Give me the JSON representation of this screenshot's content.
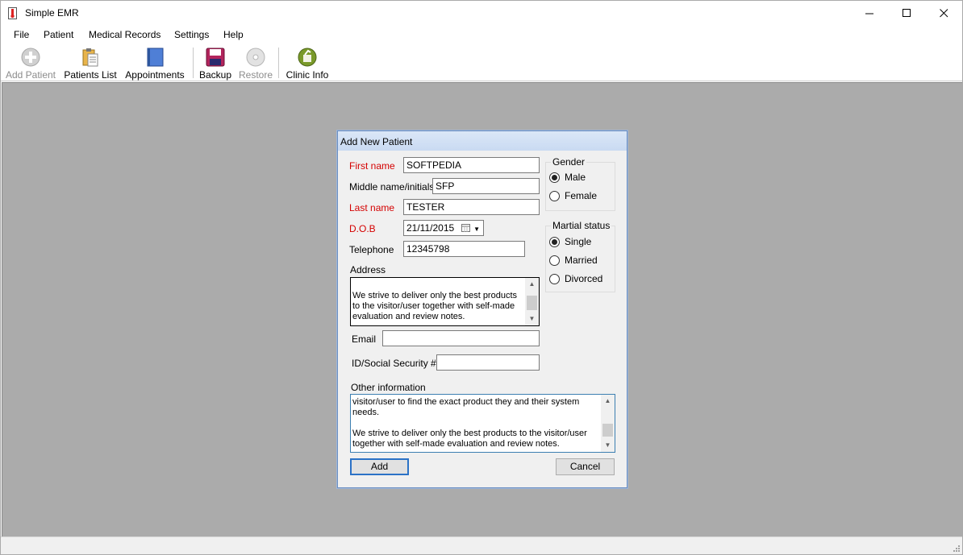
{
  "window": {
    "title": "Simple EMR"
  },
  "menu": [
    "File",
    "Patient",
    "Medical Records",
    "Settings",
    "Help"
  ],
  "toolbar": {
    "add_patient": "Add Patient",
    "patients_list": "Patients List",
    "appointments": "Appointments",
    "backup": "Backup",
    "restore": "Restore",
    "clinic_info": "Clinic Info"
  },
  "dialog": {
    "title": "Add New Patient",
    "first_name_label": "First name",
    "first_name_value": "SOFTPEDIA",
    "middle_label": "Middle name/initials",
    "middle_value": "SFP",
    "last_name_label": "Last name",
    "last_name_value": "TESTER",
    "dob_label": "D.O.B",
    "dob_value": "21/11/2015",
    "telephone_label": "Telephone",
    "telephone_value": "12345798",
    "address_label": "Address",
    "address_value": "We strive to deliver only the best products to the visitor/user together with self-made evaluation and review notes.",
    "email_label": "Email",
    "email_value": "",
    "id_label": "ID/Social Security #",
    "id_value": "",
    "other_label": "Other information",
    "other_value": "visitor/user to find the exact product they and their system needs.\n\nWe strive to deliver only the best products to the visitor/user together with self-made evaluation and review notes.",
    "gender": {
      "title": "Gender",
      "options": [
        "Male",
        "Female"
      ],
      "selected": "Male"
    },
    "marital": {
      "title": "Martial status",
      "options": [
        "Single",
        "Married",
        "Divorced"
      ],
      "selected": "Single"
    },
    "add_button": "Add",
    "cancel_button": "Cancel"
  }
}
